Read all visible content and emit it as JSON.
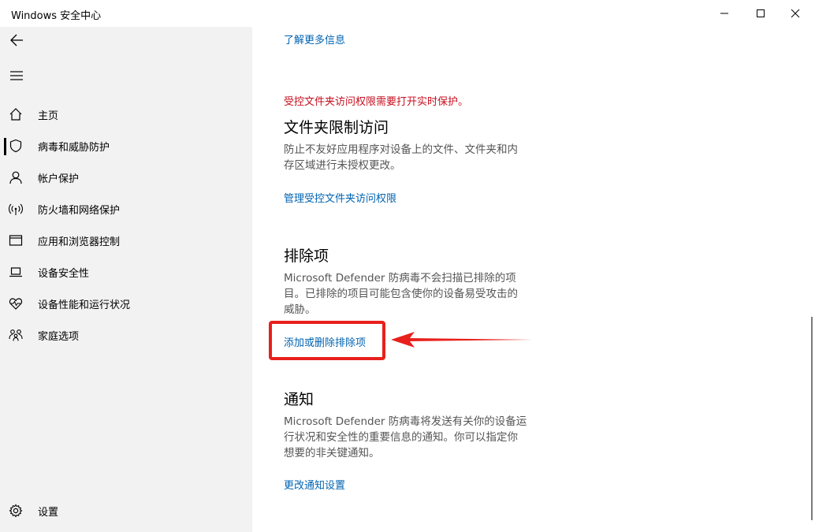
{
  "window": {
    "title": "Windows 安全中心",
    "controls": [
      "minimize-icon",
      "maximize-icon",
      "close-icon"
    ]
  },
  "sidebar": {
    "back_icon": "back-arrow-icon",
    "menu_icon": "hamburger-icon",
    "items": [
      {
        "label": "主页",
        "icon": "home-icon"
      },
      {
        "label": "病毒和威胁防护",
        "icon": "shield-icon",
        "selected": true
      },
      {
        "label": "帐户保护",
        "icon": "person-icon"
      },
      {
        "label": "防火墙和网络保护",
        "icon": "wifi-signal-icon"
      },
      {
        "label": "应用和浏览器控制",
        "icon": "browser-window-icon"
      },
      {
        "label": "设备安全性",
        "icon": "laptop-icon"
      },
      {
        "label": "设备性能和运行状况",
        "icon": "heart-pulse-icon"
      },
      {
        "label": "家庭选项",
        "icon": "family-icon"
      }
    ],
    "settings": {
      "label": "设置",
      "icon": "gear-icon"
    }
  },
  "main": {
    "learn_more": "了解更多信息",
    "warning": "受控文件夹访问权限需要打开实时保护。",
    "folder_access": {
      "title": "文件夹限制访问",
      "desc_line1": "防止不友好应用程序对设备上的文件、文件夹和内",
      "desc_line2": "存区域进行未授权更改。",
      "link": "管理受控文件夹访问权限"
    },
    "exclusions": {
      "title": "排除项",
      "desc_line1": "Microsoft Defender 防病毒不会扫描已排除的项",
      "desc_line2": "目。已排除的项目可能包含使你的设备易受攻击的",
      "desc_line3": "威胁。",
      "link": "添加或删除排除项"
    },
    "notifications": {
      "title": "通知",
      "desc_line1": "Microsoft Defender 防病毒将发送有关你的设备运",
      "desc_line2": "行状况和安全性的重要信息的通知。你可以指定你",
      "desc_line3": "想要的非关键通知。",
      "link": "更改通知设置"
    }
  },
  "colors": {
    "link": "#0063b1",
    "warning": "#c50f1f",
    "annotation": "#e8201c",
    "sidebar_bg": "#f2f2f2"
  }
}
